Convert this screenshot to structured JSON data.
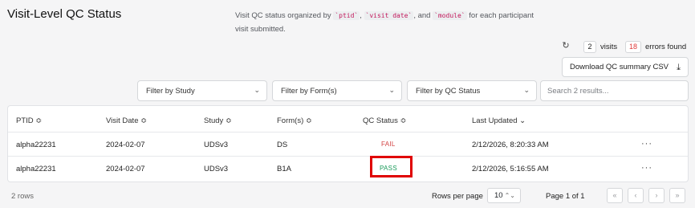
{
  "header": {
    "title": "Visit-Level QC Status",
    "description_prefix": "Visit QC status organized by",
    "code_ptid": "`ptid`",
    "code_visit_date": "`visit date`",
    "and_text": ", and",
    "code_module": "`module`",
    "description_suffix": "for each participant visit submitted."
  },
  "summary": {
    "visits_count": "2",
    "visits_label": "visits",
    "errors_count": "18",
    "errors_label": "errors found",
    "download_label": "Download QC summary CSV"
  },
  "filters": {
    "study": "Filter by Study",
    "forms": "Filter by Form(s)",
    "qc_status": "Filter by QC Status",
    "search_placeholder": "Search 2 results..."
  },
  "table": {
    "headers": {
      "ptid": "PTID ≎",
      "visit_date": "Visit Date ≎",
      "study": "Study ≎",
      "forms": "Form(s) ≎",
      "qc_status": "QC Status ≎",
      "last_updated": "Last Updated ⌄"
    },
    "rows": [
      {
        "ptid": "alpha22231",
        "visit_date": "2024-02-07",
        "study": "UDSv3",
        "forms": "DS",
        "qc_status": "FAIL",
        "last_updated": "2/12/2026, 8:20:33 AM",
        "actions": "···"
      },
      {
        "ptid": "alpha22231",
        "visit_date": "2024-02-07",
        "study": "UDSv3",
        "forms": "B1A",
        "qc_status": "PASS",
        "last_updated": "2/12/2026, 5:16:55 AM",
        "actions": "···"
      }
    ]
  },
  "footer": {
    "rows_count": "2 rows",
    "rows_per_page_label": "Rows per page",
    "rows_per_page_value": "10",
    "page_info": "Page 1 of 1"
  },
  "icons": {
    "refresh": "refresh-icon",
    "download": "download-icon",
    "chevron": "chevron-down-icon",
    "more": "more-horizontal-icon",
    "first_page": "chevrons-left-icon",
    "prev_page": "chevron-left-icon",
    "next_page": "chevron-right-icon",
    "last_page": "chevrons-right-icon"
  },
  "colors": {
    "fail": "#d23f3f",
    "pass": "#1a9a5a",
    "highlight": "#e00000",
    "errors_count": "#e03a3a"
  }
}
